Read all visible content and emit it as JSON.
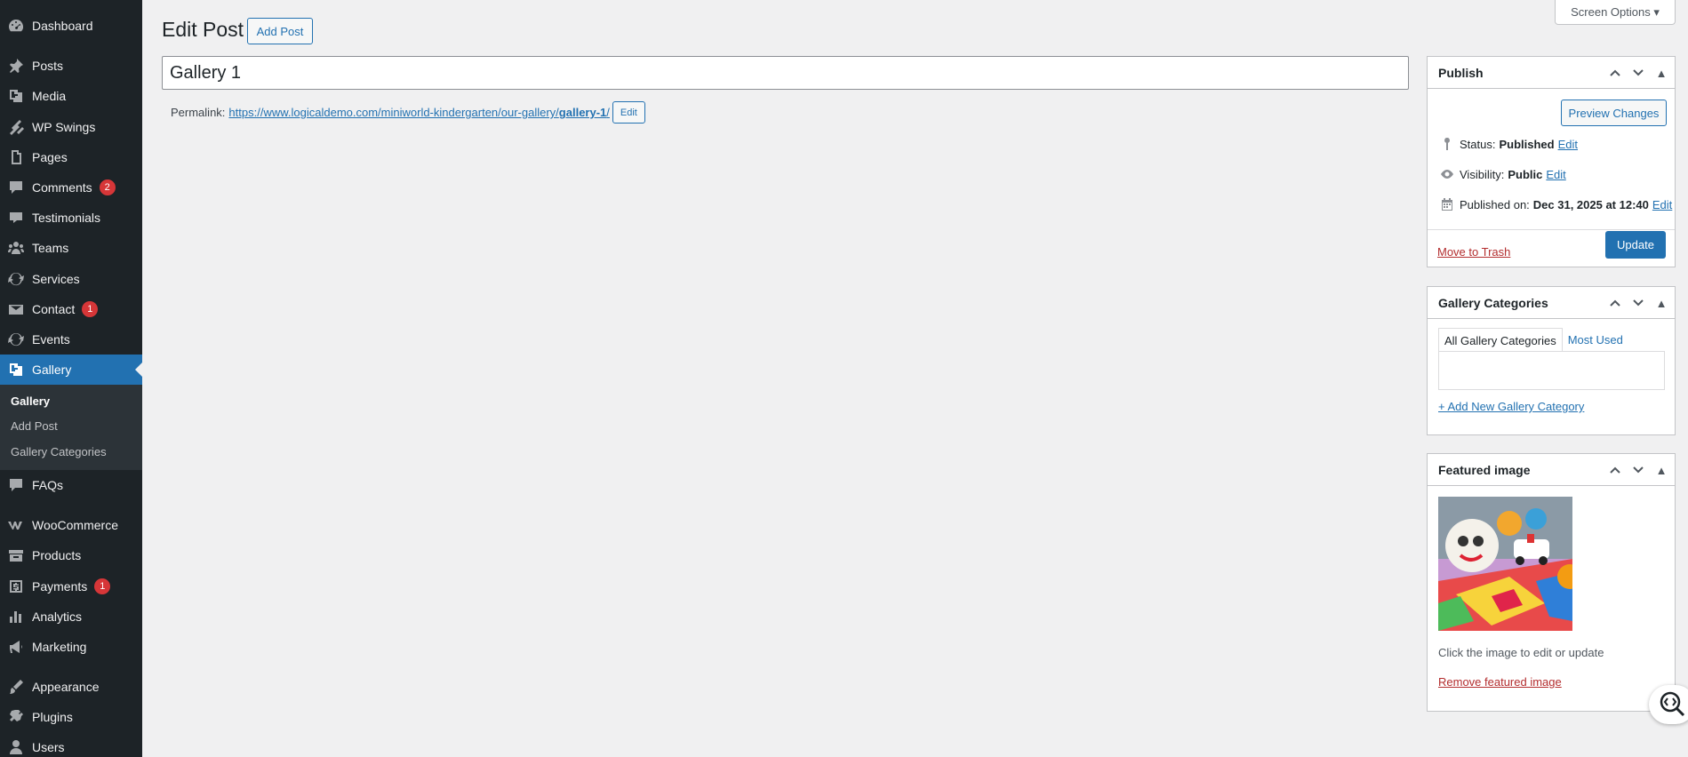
{
  "sidebar": {
    "items": [
      {
        "label": "Dashboard",
        "icon": "dashboard-icon"
      },
      {
        "label": "Posts",
        "icon": "pin-icon"
      },
      {
        "label": "Media",
        "icon": "media-icon"
      },
      {
        "label": "WP Swings",
        "icon": "wp-swings-icon"
      },
      {
        "label": "Pages",
        "icon": "pages-icon"
      },
      {
        "label": "Comments",
        "icon": "comments-icon",
        "badge": "2"
      },
      {
        "label": "Testimonials",
        "icon": "testimonial-icon"
      },
      {
        "label": "Teams",
        "icon": "teams-icon"
      },
      {
        "label": "Services",
        "icon": "services-icon"
      },
      {
        "label": "Contact",
        "icon": "mail-icon",
        "badge": "1"
      },
      {
        "label": "Events",
        "icon": "events-icon"
      },
      {
        "label": "Gallery",
        "icon": "gallery-icon"
      },
      {
        "label": "FAQs",
        "icon": "faq-icon"
      },
      {
        "label": "WooCommerce",
        "icon": "woocommerce-icon"
      },
      {
        "label": "Products",
        "icon": "products-icon"
      },
      {
        "label": "Payments",
        "icon": "payments-icon",
        "badge": "1"
      },
      {
        "label": "Analytics",
        "icon": "analytics-icon"
      },
      {
        "label": "Marketing",
        "icon": "marketing-icon"
      },
      {
        "label": "Appearance",
        "icon": "appearance-icon"
      },
      {
        "label": "Plugins",
        "icon": "plugins-icon"
      },
      {
        "label": "Users",
        "icon": "users-icon"
      }
    ],
    "submenu": [
      {
        "label": "Gallery"
      },
      {
        "label": "Add Post"
      },
      {
        "label": "Gallery Categories"
      }
    ]
  },
  "header": {
    "title": "Edit Post",
    "add_button": "Add Post",
    "screen_options": "Screen Options ▾"
  },
  "post": {
    "title": "Gallery 1",
    "permalink_label": "Permalink:",
    "permalink_base": "https://www.logicaldemo.com/miniworld-kindergarten/our-gallery/",
    "permalink_slug": "gallery-1",
    "permalink_trail": "/",
    "permalink_edit": "Edit"
  },
  "publish": {
    "heading": "Publish",
    "preview_button": "Preview Changes",
    "status_label": "Status:",
    "status_value": "Published",
    "visibility_label": "Visibility:",
    "visibility_value": "Public",
    "published_label": "Published on:",
    "published_value": "Dec 31, 2025 at 12:40",
    "edit_link": "Edit",
    "trash_link": "Move to Trash",
    "update_button": "Update"
  },
  "categories": {
    "heading": "Gallery Categories",
    "tab_all": "All Gallery Categories",
    "tab_most_used": "Most Used",
    "add_link": "+ Add New Gallery Category"
  },
  "featured": {
    "heading": "Featured image",
    "note": "Click the image to edit or update",
    "remove_link": "Remove featured image"
  },
  "colors": {
    "sidebar_bg": "#1d2327",
    "accent": "#2271b1",
    "danger": "#d63638"
  }
}
